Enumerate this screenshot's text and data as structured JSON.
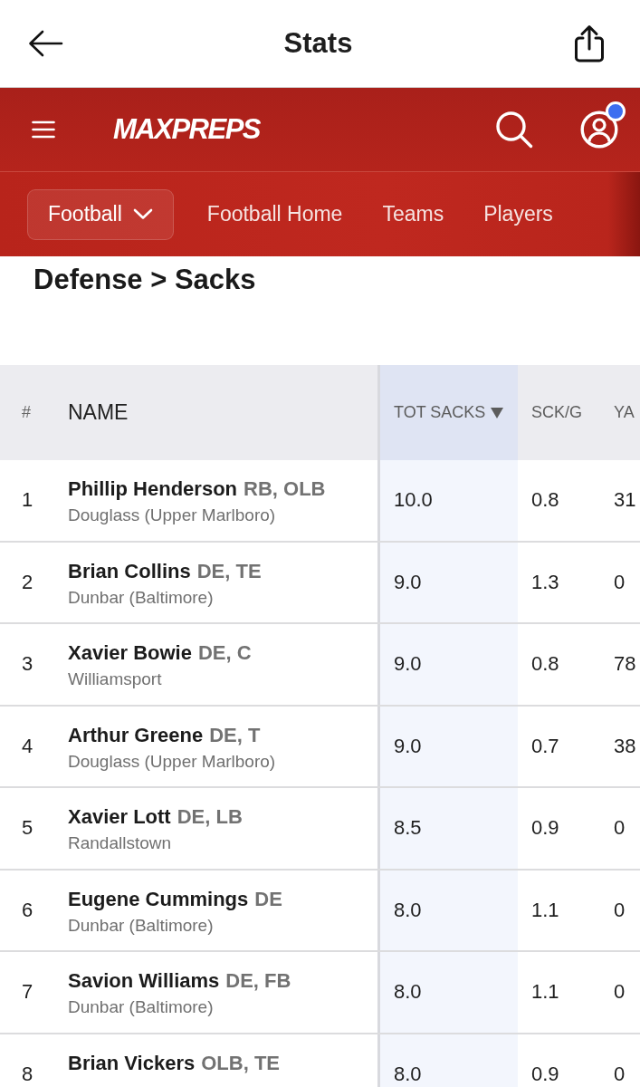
{
  "top_bar": {
    "title": "Stats"
  },
  "site_header": {
    "logo": "MAXPREPS",
    "account": {
      "notification": true
    }
  },
  "sport_nav": {
    "selector": "Football",
    "links": [
      "Football Home",
      "Teams",
      "Players"
    ]
  },
  "page_heading": "Defense > Sacks",
  "table": {
    "columns": [
      {
        "label": "#",
        "sorted": false
      },
      {
        "label": "NAME",
        "sorted": false
      },
      {
        "label": "TOT SACKS",
        "sorted": true
      },
      {
        "label": "SCK/G",
        "sorted": false
      },
      {
        "label": "YA",
        "sorted": false
      }
    ],
    "rows": [
      {
        "rank": "1",
        "name": "Phillip Henderson",
        "positions": "RB, OLB",
        "school": "Douglass (Upper Marlboro)",
        "stats": [
          "10.0",
          "0.8",
          "31"
        ]
      },
      {
        "rank": "2",
        "name": "Brian Collins",
        "positions": "DE, TE",
        "school": "Dunbar (Baltimore)",
        "stats": [
          "9.0",
          "1.3",
          "0"
        ]
      },
      {
        "rank": "3",
        "name": "Xavier Bowie",
        "positions": "DE, C",
        "school": "Williamsport",
        "stats": [
          "9.0",
          "0.8",
          "78"
        ]
      },
      {
        "rank": "4",
        "name": "Arthur Greene",
        "positions": "DE, T",
        "school": "Douglass (Upper Marlboro)",
        "stats": [
          "9.0",
          "0.7",
          "38"
        ]
      },
      {
        "rank": "5",
        "name": "Xavier Lott",
        "positions": "DE, LB",
        "school": "Randallstown",
        "stats": [
          "8.5",
          "0.9",
          "0"
        ]
      },
      {
        "rank": "6",
        "name": "Eugene Cummings",
        "positions": "DE",
        "school": "Dunbar (Baltimore)",
        "stats": [
          "8.0",
          "1.1",
          "0"
        ]
      },
      {
        "rank": "7",
        "name": "Savion Williams",
        "positions": "DE, FB",
        "school": "Dunbar (Baltimore)",
        "stats": [
          "8.0",
          "1.1",
          "0"
        ]
      },
      {
        "rank": "8",
        "name": "Brian Vickers",
        "positions": "OLB, TE",
        "stats": [
          "8.0",
          "0.9",
          "0"
        ]
      }
    ]
  }
}
